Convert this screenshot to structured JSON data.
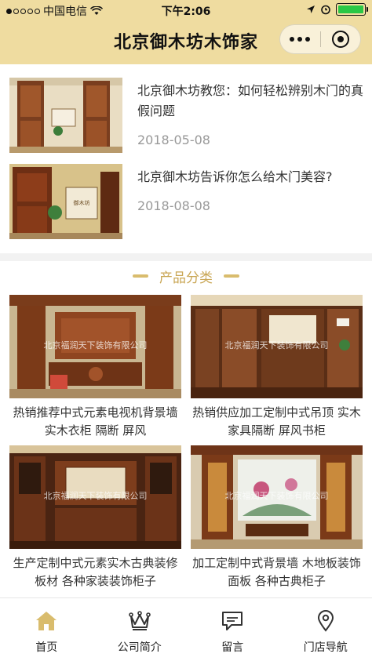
{
  "status_bar": {
    "carrier": "中国电信",
    "time": "下午2:06"
  },
  "header": {
    "title": "北京御木坊木饰家"
  },
  "articles": [
    {
      "title": "北京御木坊教您：如何轻松辨别木门的真假问题",
      "date": "2018-05-08"
    },
    {
      "title": "北京御木坊告诉你怎么给木门美容?",
      "date": "2018-08-08"
    }
  ],
  "section": {
    "title": "产品分类"
  },
  "products": [
    {
      "title": "热销推荐中式元素电视机背景墙 实木衣柜 隔断 屏风",
      "watermark": "北京福润天下装饰有限公司"
    },
    {
      "title": "热销供应加工定制中式吊顶 实木家具隔断 屏风书柜",
      "watermark": "北京福润天下装饰有限公司"
    },
    {
      "title": "生产定制中式元素实木古典装修板材 各种家装装饰柜子",
      "watermark": "北京福润天下装饰有限公司"
    },
    {
      "title": "加工定制中式背景墙 木地板装饰面板 各种古典柜子",
      "watermark": "北京福润天下装饰有限公司"
    }
  ],
  "tabbar": [
    {
      "label": "首页",
      "icon": "home-icon",
      "active": true
    },
    {
      "label": "公司简介",
      "icon": "crown-icon",
      "active": false
    },
    {
      "label": "留言",
      "icon": "chat-icon",
      "active": false
    },
    {
      "label": "门店导航",
      "icon": "location-pin-icon",
      "active": false
    }
  ],
  "colors": {
    "header_bg": "#efdca0",
    "accent": "#c9a654",
    "active_icon": "#d9bc6d"
  }
}
